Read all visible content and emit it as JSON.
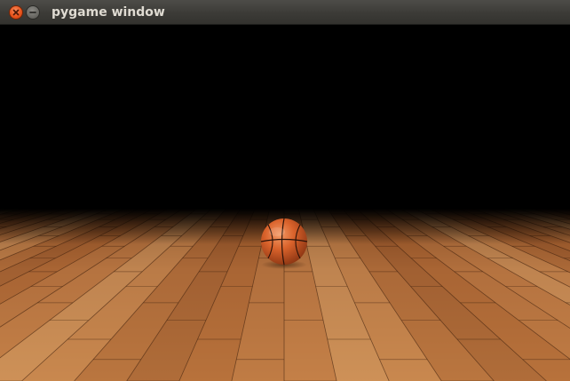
{
  "window": {
    "title": "pygame window"
  },
  "scene": {
    "backdrop_color": "#000000",
    "floor_color_light": "#c9854a",
    "floor_color_dark": "#6b3a1a",
    "ball_color": "#d9622b",
    "ball_seam_color": "#2a1208"
  },
  "icons": {
    "close": "close-icon",
    "minimize": "minimize-icon",
    "ball": "basketball-icon"
  }
}
